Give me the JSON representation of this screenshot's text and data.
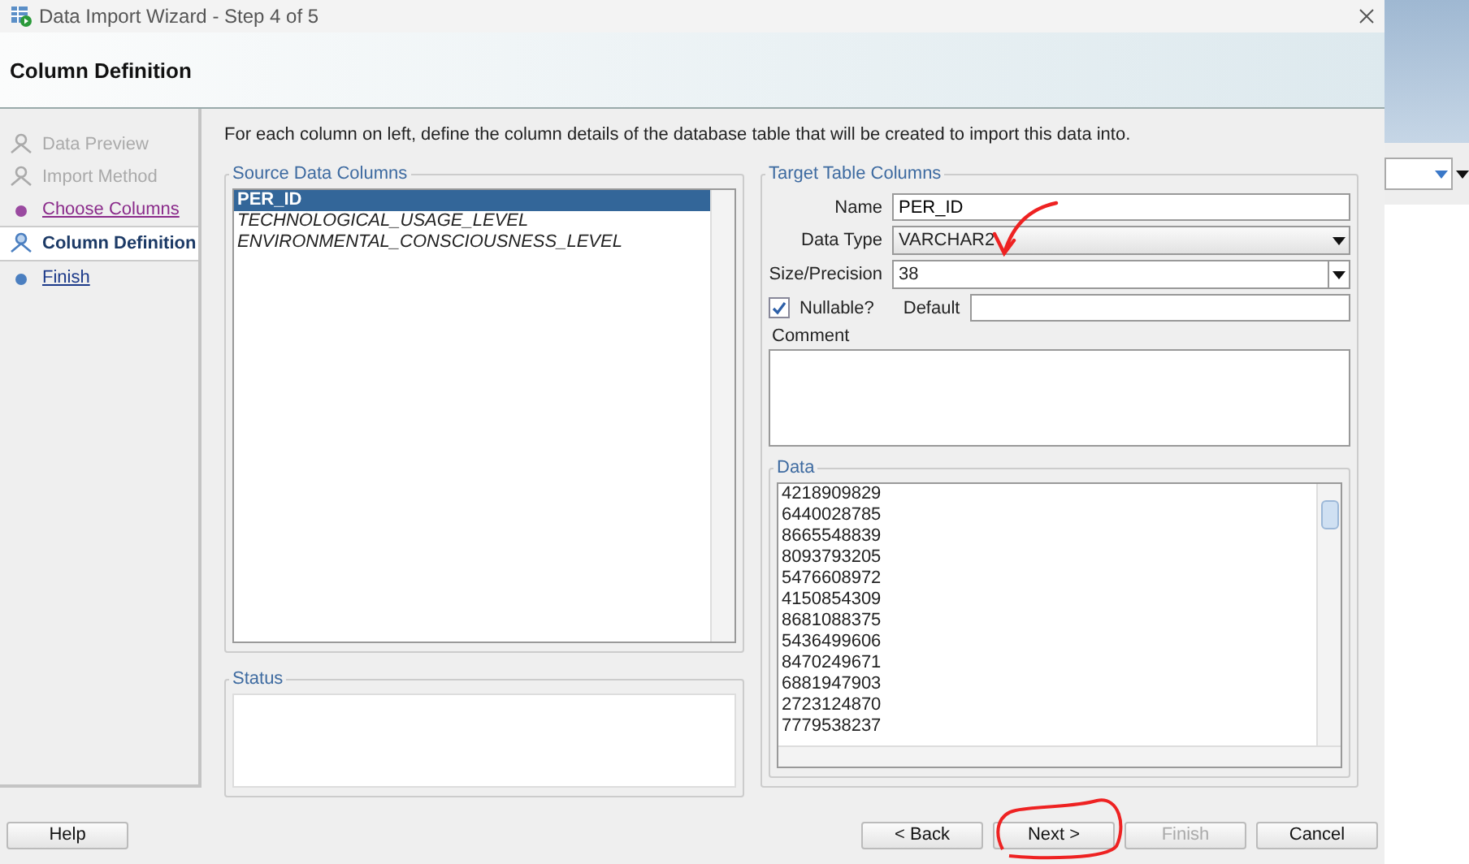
{
  "window": {
    "title": "Data Import Wizard - Step 4 of 5"
  },
  "header": {
    "title": "Column Definition"
  },
  "steps": [
    {
      "label": "Data Preview",
      "kind": "done",
      "selected": false
    },
    {
      "label": "Import Method",
      "kind": "done",
      "selected": false
    },
    {
      "label": "Choose Columns",
      "kind": "visited",
      "selected": false
    },
    {
      "label": "Column Definition",
      "kind": "current",
      "selected": true
    },
    {
      "label": "Finish",
      "kind": "next",
      "selected": false
    }
  ],
  "instructions": "For each column on left, define the column details of the database table that will be created to import this data into.",
  "source_columns": {
    "title": "Source Data Columns",
    "items": [
      {
        "label": "PER_ID",
        "selected": true
      },
      {
        "label": "TECHNOLOGICAL_USAGE_LEVEL",
        "selected": false
      },
      {
        "label": "ENVIRONMENTAL_CONSCIOUSNESS_LEVEL",
        "selected": false
      }
    ]
  },
  "status": {
    "title": "Status"
  },
  "target": {
    "title": "Target Table Columns",
    "name": {
      "label": "Name",
      "value": "PER_ID"
    },
    "data_type": {
      "label": "Data Type",
      "value": "VARCHAR2"
    },
    "size": {
      "label": "Size/Precision",
      "value": "38"
    },
    "nullable": {
      "label": "Nullable?",
      "checked": true
    },
    "default": {
      "label": "Default"
    },
    "comment": {
      "label": "Comment"
    },
    "data": {
      "title": "Data",
      "rows": [
        "4218909829",
        "6440028785",
        "8665548839",
        "8093793205",
        "5476608972",
        "4150854309",
        "8681088375",
        "5436499606",
        "8470249671",
        "6881947903",
        "2723124870",
        "7779538237"
      ]
    }
  },
  "buttons": [
    {
      "label": "Help",
      "kind": "help",
      "disabled": false
    },
    {
      "label": "< Back",
      "kind": "nav",
      "disabled": false
    },
    {
      "label": "Next >",
      "kind": "nav",
      "disabled": false
    },
    {
      "label": "Finish",
      "kind": "nav",
      "disabled": true
    },
    {
      "label": "Cancel",
      "kind": "nav",
      "disabled": false
    }
  ]
}
